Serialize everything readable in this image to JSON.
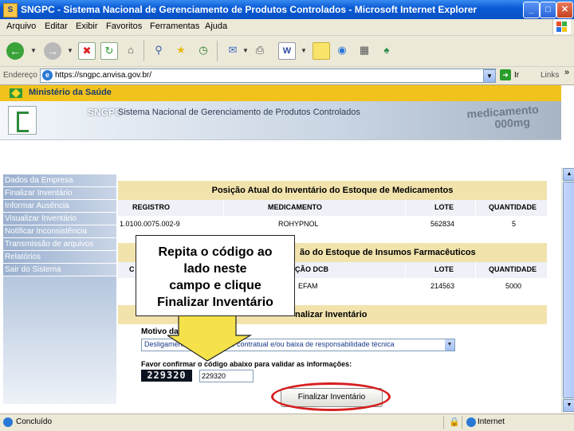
{
  "window": {
    "title": "SNGPC - Sistema Nacional de Gerenciamento de Produtos Controlados - Microsoft Internet Explorer",
    "controls": [
      "_",
      "□",
      "✕"
    ]
  },
  "menu": [
    "Arquivo",
    "Editar",
    "Exibir",
    "Favoritos",
    "Ferramentas",
    "Ajuda"
  ],
  "address": {
    "label": "Endereço",
    "url": "https://sngpc.anvisa.gov.br/",
    "go_label": "Ir",
    "links_label": "Links",
    "links_chevron": "»"
  },
  "page": {
    "ministry": "Ministério da Saúde",
    "banner_acronym": "SNGPC",
    "banner_fullname": "Sistema Nacional de Gerenciamento de Produtos Controlados",
    "banner_med_line1": "medicamento",
    "banner_med_line2": "000mg",
    "nav": [
      "Dados da Empresa",
      "Finalizar Inventário",
      "Informar Ausência",
      "Visualizar Inventário",
      "Notificar Inconsistência",
      "Transmissão de arquivos",
      "Relatórios",
      "Sair do Sistema"
    ],
    "panel1": {
      "title": "Posição Atual do Inventário do Estoque de Medicamentos",
      "headers": [
        "REGISTRO",
        "MEDICAMENTO",
        "LOTE",
        "QUANTIDADE"
      ],
      "row": [
        "1.0100.0075.002-9",
        "ROHYPNOL",
        "562834",
        "5"
      ]
    },
    "panel2": {
      "title_partial": "ão do Estoque de Insumos Farmacêuticos",
      "header_first": "C",
      "headers": [
        "ÇÃO DCB",
        "LOTE",
        "QUANTIDADE"
      ],
      "row": [
        "EFAM",
        "214563",
        "5000"
      ]
    },
    "panel3": {
      "title_partial": "nalizar Inventário"
    },
    "form": {
      "motivo_label": "Motivo da Fin",
      "motivo_selected": "Desligamento do ... rescisão contratual e/ou baixa de responsabilidade técnica",
      "confirm_label": "Favor confirmar o código abaixo para validar as informações:",
      "captcha": "229320",
      "code_value": "229320",
      "finalize_button": "Finalizar Inventário"
    },
    "callout": "Repita o código ao\nlado neste\ncampo e clique\nFinalizar Inventário"
  },
  "status": {
    "text": "Concluído",
    "zone": "Internet"
  },
  "colors": {
    "titlebar": "#0a5bd6",
    "ministry_bar": "#f1c21b",
    "panel_title": "#f2e3ad",
    "highlight_ring": "#d61f1f",
    "callout_arrow": "#f5e24a"
  }
}
